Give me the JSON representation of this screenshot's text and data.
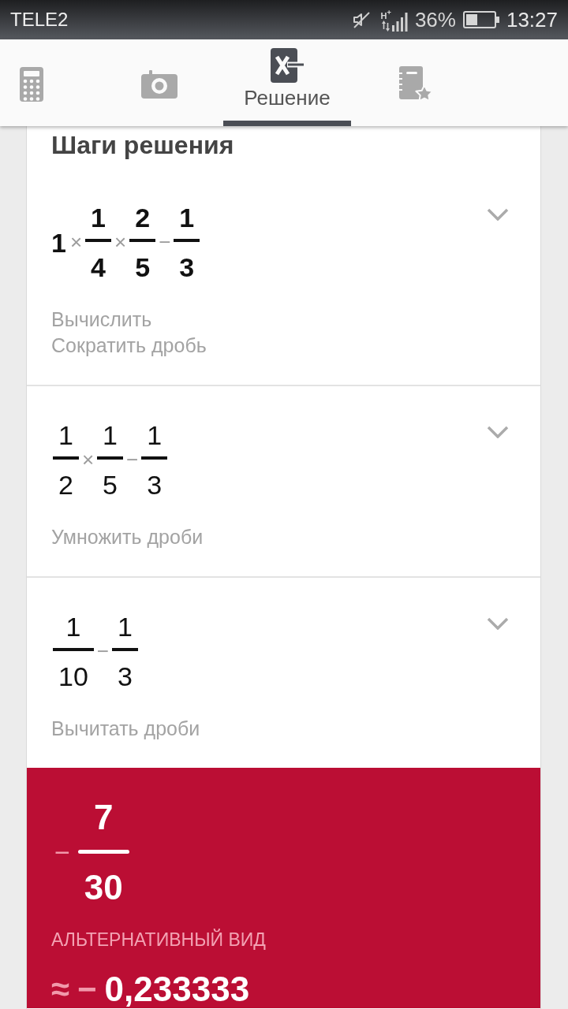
{
  "status_bar": {
    "carrier": "TELE2",
    "network": "H$^{+}$",
    "battery": "36%",
    "time": "13:27"
  },
  "tabs": [
    {
      "selected": false
    },
    {
      "selected": false
    },
    {
      "label": "Решение",
      "selected": true
    },
    {
      "selected": false
    }
  ],
  "heading": "Шаги решения",
  "steps": [
    {
      "kind": "input",
      "expanded": false,
      "expression": [
        {
          "kind": "number",
          "text": "1"
        },
        {
          "kind": "operator",
          "text": "×"
        },
        {
          "kind": "fraction",
          "numerator": "1",
          "denominator": "4"
        },
        {
          "kind": "operator",
          "text": "×"
        },
        {
          "kind": "fraction",
          "numerator": "2",
          "denominator": "5"
        },
        {
          "kind": "operator",
          "text": "−"
        },
        {
          "kind": "fraction",
          "numerator": "1",
          "denominator": "3"
        }
      ],
      "descriptions": [
        "Вычислить",
        "Сократить дробь"
      ]
    },
    {
      "kind": "step",
      "expanded": false,
      "expression": [
        {
          "kind": "fraction",
          "numerator": "1",
          "denominator": "2"
        },
        {
          "kind": "operator",
          "text": "×"
        },
        {
          "kind": "fraction",
          "numerator": "1",
          "denominator": "5"
        },
        {
          "kind": "operator",
          "text": "−"
        },
        {
          "kind": "fraction",
          "numerator": "1",
          "denominator": "3"
        }
      ],
      "descriptions": [
        "Умножить дроби"
      ]
    },
    {
      "kind": "step",
      "expanded": false,
      "expression": [
        {
          "kind": "fraction",
          "numerator": "1",
          "denominator": "10"
        },
        {
          "kind": "operator",
          "text": "−"
        },
        {
          "kind": "fraction",
          "numerator": "1",
          "denominator": "3"
        }
      ],
      "descriptions": [
        "Вычитать дроби"
      ]
    }
  ],
  "result": {
    "sign": "−",
    "numerator": "7",
    "denominator": "30",
    "alt_label": "АЛЬТЕРНАТИВНЫЙ ВИД",
    "approx_symbol": "≈",
    "approx_sign": "−",
    "approx_value": "0,233333"
  }
}
